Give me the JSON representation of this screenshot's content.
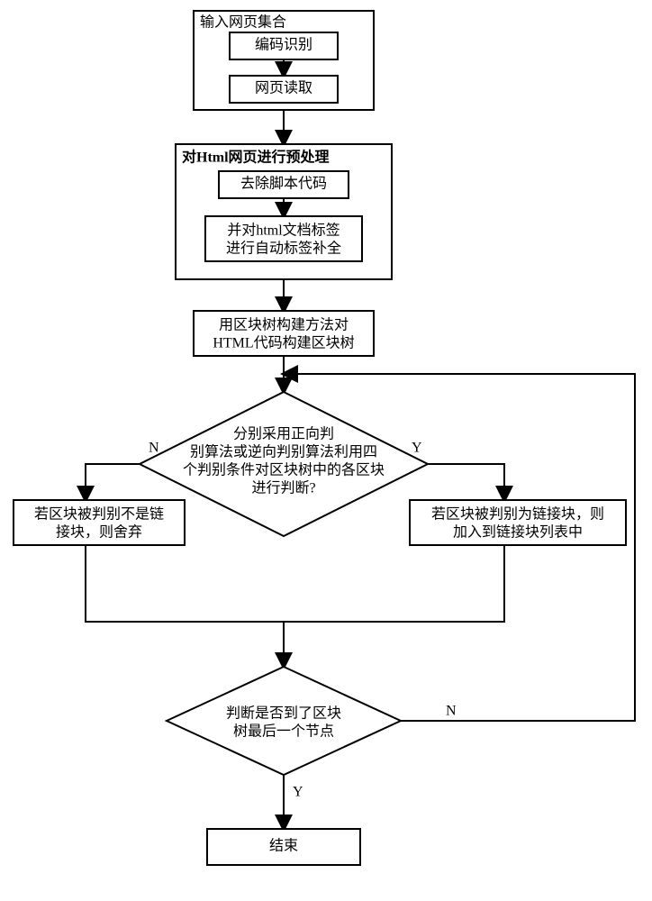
{
  "stage1": {
    "title": "输入网页集合",
    "step1": "编码识别",
    "step2": "网页读取"
  },
  "stage2": {
    "title": "对Html网页进行预处理",
    "step1": "去除脚本代码",
    "step2_l1": "并对html文档标签",
    "step2_l2": "进行自动标签补全"
  },
  "stage3": {
    "l1": "用区块树构建方法对",
    "l2": "HTML代码构建区块树"
  },
  "decision1": {
    "l1": "分别采用正向判",
    "l2": "别算法或逆向判别算法利用四",
    "l3": "个判别条件对区块树中的各区块",
    "l4": "进行判断?"
  },
  "branchN": {
    "l1": "若区块被判别不是链",
    "l2": "接块，则舍弃"
  },
  "branchY": {
    "l1": "若区块被判别为链接块，则",
    "l2": "加入到链接块列表中"
  },
  "decision2": {
    "l1": "判断是否到了区块",
    "l2": "树最后一个节点"
  },
  "labels": {
    "yes": "Y",
    "no": "N"
  },
  "end": "结束"
}
